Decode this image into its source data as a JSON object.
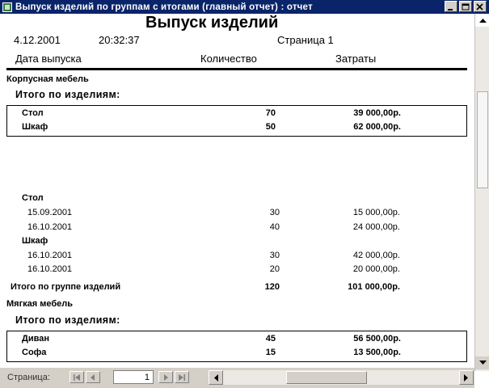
{
  "window": {
    "title": "Выпуск изделий по группам с итогами (главный отчет) : отчет"
  },
  "report": {
    "title": "Выпуск изделий",
    "date": "4.12.2001",
    "time": "20:32:37",
    "page_label": "Страница 1",
    "columns": [
      "Дата выпуска",
      "Количество",
      "Затраты"
    ],
    "groups": [
      {
        "name": "Корпусная мебель",
        "summary_label": "Итого по изделиям:",
        "summary_rows": [
          {
            "item": "Стол",
            "qty": "70",
            "cost": "39 000,00р."
          },
          {
            "item": "Шкаф",
            "qty": "50",
            "cost": "62 000,00р."
          }
        ],
        "details": [
          {
            "item": "Стол",
            "rows": [
              {
                "date": "15.09.2001",
                "qty": "30",
                "cost": "15 000,00р."
              },
              {
                "date": "16.10.2001",
                "qty": "40",
                "cost": "24 000,00р."
              }
            ]
          },
          {
            "item": "Шкаф",
            "rows": [
              {
                "date": "16.10.2001",
                "qty": "30",
                "cost": "42 000,00р."
              },
              {
                "date": "16.10.2001",
                "qty": "20",
                "cost": "20 000,00р."
              }
            ]
          }
        ],
        "group_total": {
          "label": "Итого по группе изделий",
          "qty": "120",
          "cost": "101 000,00р."
        }
      },
      {
        "name": "Мягкая мебель",
        "summary_label": "Итого по изделиям:",
        "summary_rows": [
          {
            "item": "Диван",
            "qty": "45",
            "cost": "56 500,00р."
          },
          {
            "item": "Софа",
            "qty": "15",
            "cost": "13 500,00р."
          }
        ]
      }
    ]
  },
  "statusbar": {
    "page_label": "Страница:",
    "page_value": "1"
  },
  "colors": {
    "titlebar": "#0a246a",
    "chrome": "#d4d0c8"
  },
  "icons": [
    "app-icon",
    "minimize-icon",
    "maximize-icon",
    "close-icon",
    "first-page-icon",
    "prev-page-icon",
    "next-page-icon",
    "last-page-icon",
    "scroll-up-icon",
    "scroll-down-icon",
    "scroll-left-icon",
    "scroll-right-icon"
  ]
}
